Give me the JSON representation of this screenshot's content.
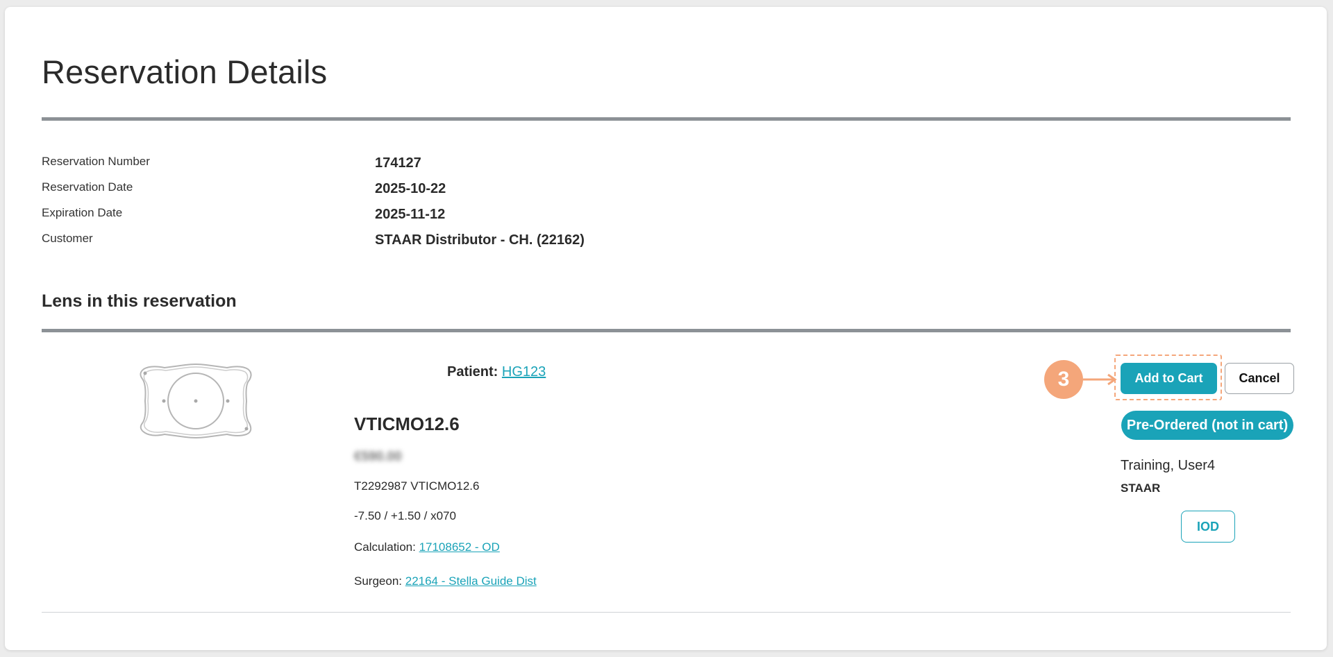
{
  "page": {
    "title": "Reservation Details"
  },
  "info": {
    "rows": [
      {
        "label": "Reservation Number",
        "value": "174127"
      },
      {
        "label": "Reservation Date",
        "value": "2025-10-22"
      },
      {
        "label": "Expiration Date",
        "value": "2025-11-12"
      },
      {
        "label": "Customer",
        "value": "STAAR Distributor - CH. (22162)"
      }
    ]
  },
  "lens_section": {
    "title": "Lens in this reservation"
  },
  "lens": {
    "patient_label": "Patient:",
    "patient_id": "HG123",
    "product_name": "VTICMO12.6",
    "price": "€590.00",
    "serial": "T2292987 VTICMO12.6",
    "power": "-7.50 / +1.50 / x070",
    "calculation_label": "Calculation:",
    "calculation_value": "17108652 - OD",
    "surgeon_label": "Surgeon:",
    "surgeon_value": "22164 - Stella Guide Dist"
  },
  "actions": {
    "add_to_cart_label": "Add to Cart",
    "cancel_label": "Cancel",
    "status_badge": "Pre-Ordered (not in cart)",
    "user_name": "Training, User4",
    "user_org": "STAAR",
    "iod_label": "IOD"
  },
  "annotation": {
    "step_number": "3",
    "color": "#f4a67a"
  },
  "colors": {
    "accent": "#1aa3b8",
    "divider": "#8c9196"
  },
  "icons": {
    "lens": "lens-image-icon",
    "step_arrow": "arrow-right-icon"
  }
}
